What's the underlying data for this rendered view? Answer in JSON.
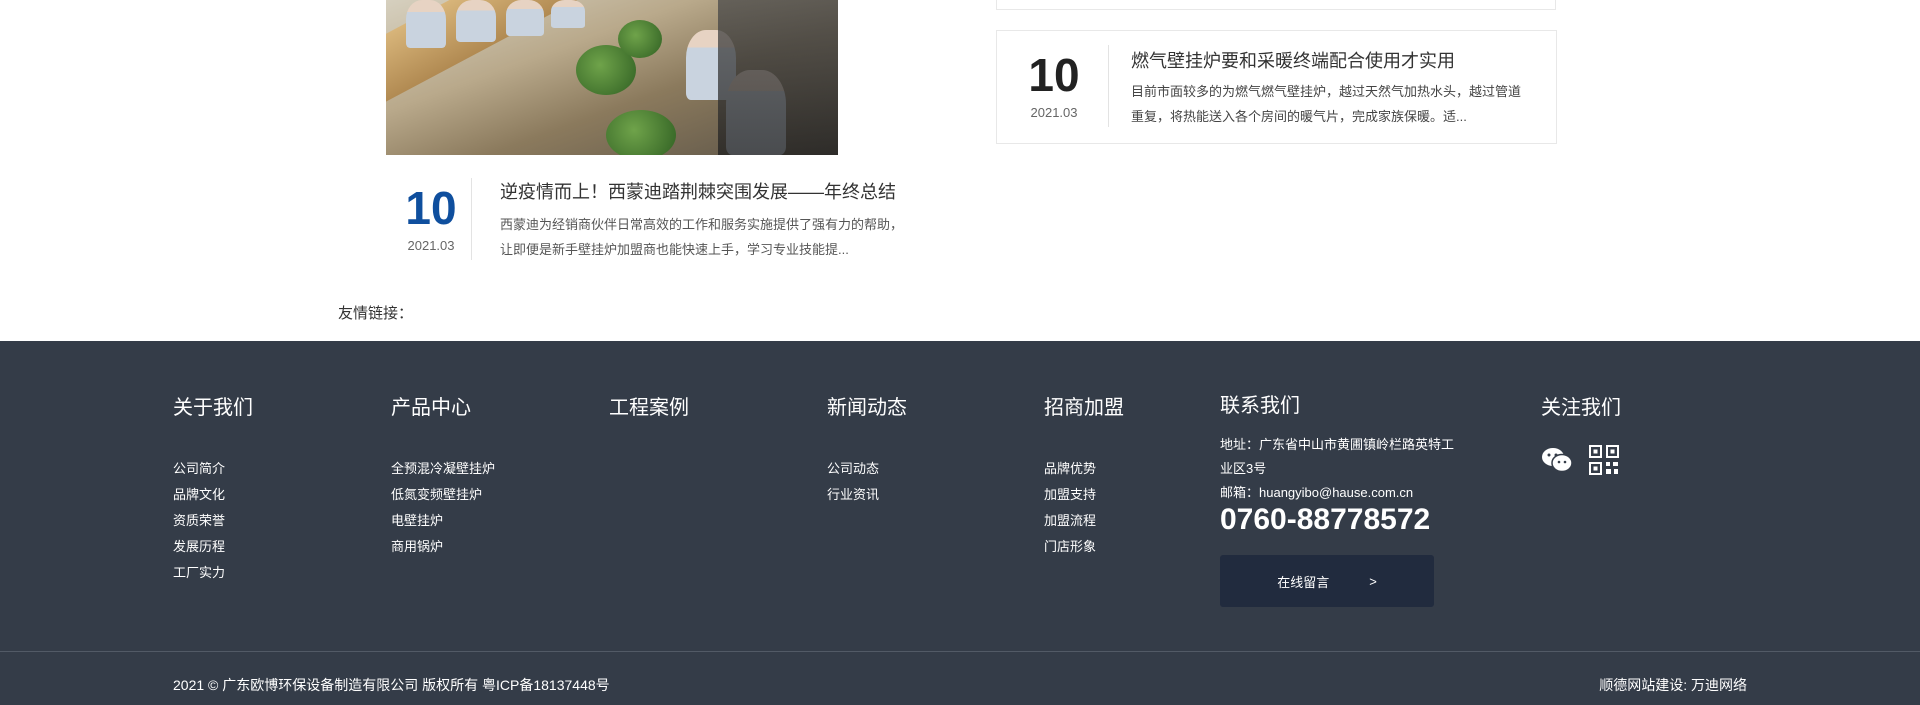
{
  "left_news": {
    "day": "10",
    "year_month": "2021.03",
    "title": "逆疫情而上！西蒙迪踏荆棘突围发展——年终总结",
    "desc": "西蒙迪为经销商伙伴日常高效的工作和服务实施提供了强有力的帮助，让即便是新手壁挂炉加盟商也能快速上手，学习专业技能提..."
  },
  "right_news": {
    "day": "10",
    "year_month": "2021.03",
    "title": "燃气壁挂炉要和采暖终端配合使用才实用",
    "desc": "目前市面较多的为燃气燃气壁挂炉，越过天然气加热水头，越过管道重复，将热能送入各个房间的暖气片，完成家族保暖。适..."
  },
  "friend_links": {
    "label": "友情链接："
  },
  "footer": {
    "columns": [
      {
        "title": "关于我们",
        "items": [
          "公司简介",
          "品牌文化",
          "资质荣誉",
          "发展历程",
          "工厂实力"
        ]
      },
      {
        "title": "产品中心",
        "items": [
          "全预混冷凝壁挂炉",
          "低氮变频壁挂炉",
          "电壁挂炉",
          "商用锅炉"
        ]
      },
      {
        "title": "工程案例",
        "items": []
      },
      {
        "title": "新闻动态",
        "items": [
          "公司动态",
          "行业资讯"
        ]
      },
      {
        "title": "招商加盟",
        "items": [
          "品牌优势",
          "加盟支持",
          "加盟流程",
          "门店形象"
        ]
      }
    ],
    "contact": {
      "title": "联系我们",
      "address": "地址：广东省中山市黄圃镇岭栏路英特工业区3号",
      "email": "邮箱：huangyibo@hause.com.cn",
      "phone": "0760-88778572",
      "button_label": "在线留言",
      "button_arrow": ">"
    },
    "follow": {
      "title": "关注我们",
      "icons": [
        "wechat-icon",
        "qrcode-icon"
      ]
    },
    "copyright": "2021 © 广东欧博环保设备制造有限公司 版权所有 粤ICP备18137448号",
    "builder": "顺德网站建设: 万迪网络"
  },
  "colors": {
    "footer_bg": "#343c48",
    "button_bg": "#212b3e",
    "left_date_accent": "#0f4f9e",
    "right_date_color": "#222222"
  }
}
